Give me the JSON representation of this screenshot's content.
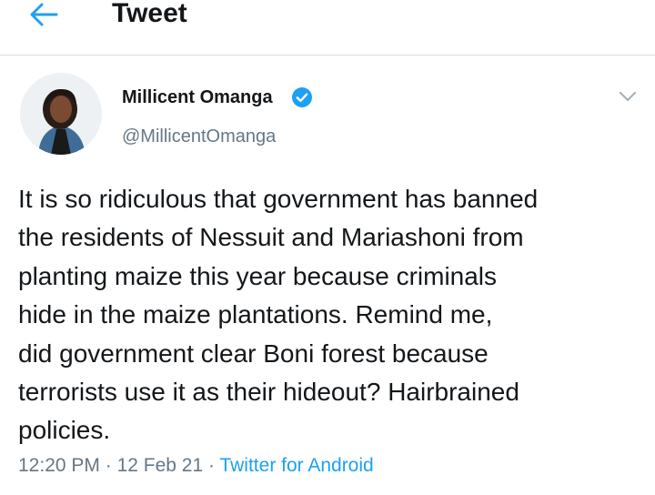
{
  "header": {
    "title": "Tweet",
    "back_icon": "arrow-left-icon"
  },
  "user": {
    "display_name": "Millicent Omanga",
    "handle": "@MillicentOmanga",
    "verified": true
  },
  "tweet": {
    "text": "It is so ridiculous that government has banned\nthe residents of Nessuit and Mariashoni from\nplanting maize this year because criminals\nhide in the maize plantations. Remind me,\ndid government clear Boni forest because\nterrorists use it as their hideout? Hairbrained\npolicies.",
    "time": "12:20 PM",
    "date": "12 Feb 21",
    "separator": "·",
    "source": "Twitter for Android"
  },
  "colors": {
    "accent": "#1da1f2",
    "text": "#14171a",
    "secondary": "#657786",
    "divider": "#d9dde1"
  }
}
